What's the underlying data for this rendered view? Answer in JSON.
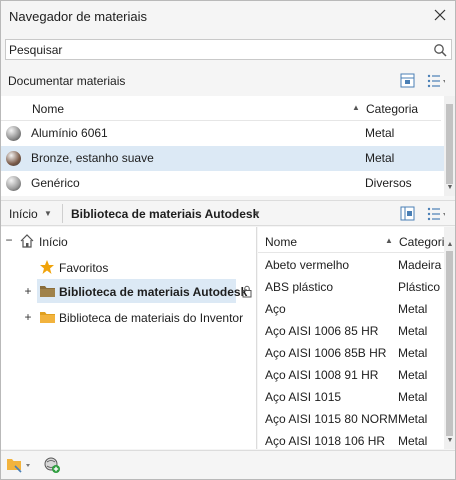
{
  "window": {
    "title": "Navegador de materiais"
  },
  "search": {
    "placeholder": "Pesquisar",
    "value": ""
  },
  "document_section": {
    "label": "Documentar materiais"
  },
  "doc_table": {
    "columns": {
      "name": "Nome",
      "category": "Categoria"
    },
    "rows": [
      {
        "name": "Alumínio 6061",
        "category": "Metal",
        "swatch": "#8d8d8d",
        "selected": false
      },
      {
        "name": "Bronze, estanho suave",
        "category": "Metal",
        "swatch": "#7a5a48",
        "selected": true
      },
      {
        "name": "Genérico",
        "category": "Diversos",
        "swatch": "#9a9a9a",
        "selected": false
      }
    ]
  },
  "breadcrumb": {
    "home": "Início",
    "library": "Biblioteca de materiais Autodesk"
  },
  "tree": {
    "root": "Início",
    "favorites": "Favoritos",
    "libraries": [
      {
        "label": "Biblioteca de materiais Autodesk",
        "selected": true,
        "locked": true
      },
      {
        "label": "Biblioteca de materiais do Inventor",
        "selected": false,
        "locked": false
      }
    ]
  },
  "library_list": {
    "columns": {
      "name": "Nome",
      "category": "Categori"
    },
    "rows": [
      {
        "name": "Abeto vermelho",
        "category": "Madeira"
      },
      {
        "name": "ABS plástico",
        "category": "Plástico"
      },
      {
        "name": "Aço",
        "category": "Metal"
      },
      {
        "name": "Aço AISI 1006 85 HR",
        "category": "Metal"
      },
      {
        "name": "Aço AISI 1006 85B HR",
        "category": "Metal"
      },
      {
        "name": "Aço AISI 1008 91 HR",
        "category": "Metal"
      },
      {
        "name": "Aço AISI 1015",
        "category": "Metal"
      },
      {
        "name": "Aço AISI 1015 80 NORM",
        "category": "Metal"
      },
      {
        "name": "Aço AISI 1018 106 HR",
        "category": "Metal"
      }
    ]
  },
  "colors": {
    "selection": "#dce9f5",
    "folder": "#f2b33d",
    "star": "#f0a30a"
  }
}
